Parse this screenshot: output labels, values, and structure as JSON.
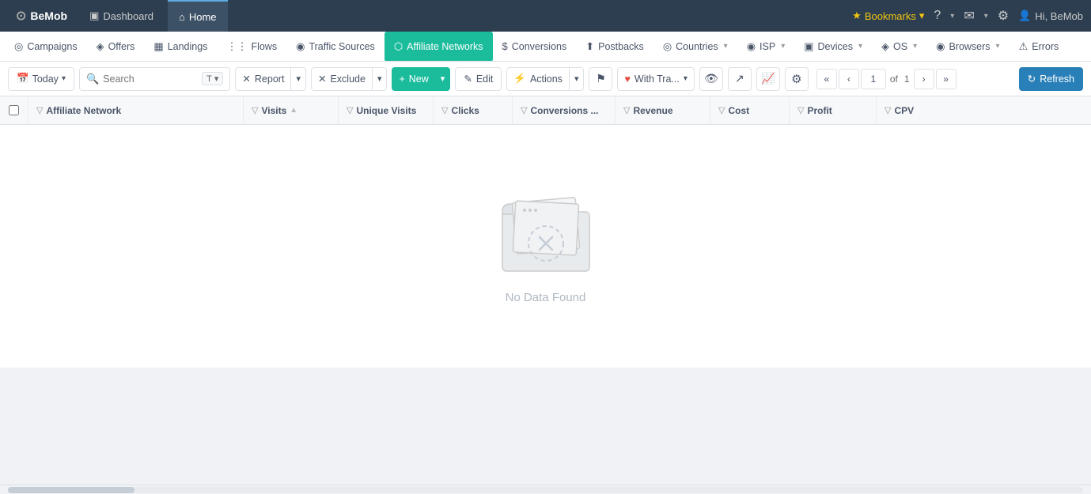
{
  "topbar": {
    "logo": "BeMob",
    "logo_icon": "⊙",
    "tabs": [
      {
        "label": "Dashboard",
        "icon": "▣",
        "active": false
      },
      {
        "label": "Home",
        "icon": "⌂",
        "active": true
      }
    ],
    "bookmarks_label": "Bookmarks",
    "help_icon": "?",
    "messages_icon": "✉",
    "settings_icon": "⚙",
    "user_label": "Hi, BeMob"
  },
  "navbar": {
    "items": [
      {
        "label": "Campaigns",
        "icon": "◎",
        "active": false,
        "has_dropdown": false
      },
      {
        "label": "Offers",
        "icon": "◈",
        "active": false,
        "has_dropdown": false
      },
      {
        "label": "Landings",
        "icon": "▦",
        "active": false,
        "has_dropdown": false
      },
      {
        "label": "Flows",
        "icon": "⋮⋮",
        "active": false,
        "has_dropdown": false
      },
      {
        "label": "Traffic Sources",
        "icon": "◉",
        "active": false,
        "has_dropdown": false
      },
      {
        "label": "Affiliate Networks",
        "icon": "⬡",
        "active": true,
        "has_dropdown": false
      },
      {
        "label": "Conversions",
        "icon": "$",
        "active": false,
        "has_dropdown": false
      },
      {
        "label": "Postbacks",
        "icon": "⬆",
        "active": false,
        "has_dropdown": false
      },
      {
        "label": "Countries",
        "icon": "◎",
        "active": false,
        "has_dropdown": true
      },
      {
        "label": "ISP",
        "icon": "◉",
        "active": false,
        "has_dropdown": true
      },
      {
        "label": "Devices",
        "icon": "▣",
        "active": false,
        "has_dropdown": true
      },
      {
        "label": "OS",
        "icon": "◈",
        "active": false,
        "has_dropdown": true
      },
      {
        "label": "Browsers",
        "icon": "◉",
        "active": false,
        "has_dropdown": true
      },
      {
        "label": "Errors",
        "icon": "⚠",
        "active": false,
        "has_dropdown": false
      }
    ]
  },
  "toolbar": {
    "today_label": "Today",
    "search_placeholder": "Search",
    "search_type": "T",
    "report_label": "Report",
    "exclude_label": "Exclude",
    "new_label": "New",
    "edit_label": "Edit",
    "edit_icon": "✎",
    "actions_label": "Actions",
    "actions_icon": "⚡",
    "flag_icon": "⚑",
    "with_tra_label": "With Tra...",
    "heart_icon": "♥",
    "eye_icon": "👁",
    "export_icon": "↗",
    "chart_icon": "📈",
    "gear_icon": "⚙",
    "page_current": "1",
    "page_total": "1",
    "refresh_label": "Refresh",
    "refresh_icon": "↻"
  },
  "table": {
    "columns": [
      {
        "label": "Affiliate Network",
        "key": "name",
        "sortable": true,
        "filterable": true
      },
      {
        "label": "Visits",
        "key": "visits",
        "sortable": true,
        "filterable": true
      },
      {
        "label": "Unique Visits",
        "key": "unique_visits",
        "sortable": false,
        "filterable": true
      },
      {
        "label": "Clicks",
        "key": "clicks",
        "sortable": false,
        "filterable": true
      },
      {
        "label": "Conversions ...",
        "key": "conversions",
        "sortable": false,
        "filterable": true
      },
      {
        "label": "Revenue",
        "key": "revenue",
        "sortable": false,
        "filterable": true
      },
      {
        "label": "Cost",
        "key": "cost",
        "sortable": false,
        "filterable": true
      },
      {
        "label": "Profit",
        "key": "profit",
        "sortable": false,
        "filterable": true
      },
      {
        "label": "CPV",
        "key": "cpv",
        "sortable": false,
        "filterable": true
      }
    ],
    "empty_state": {
      "text": "No Data Found"
    },
    "rows": []
  }
}
